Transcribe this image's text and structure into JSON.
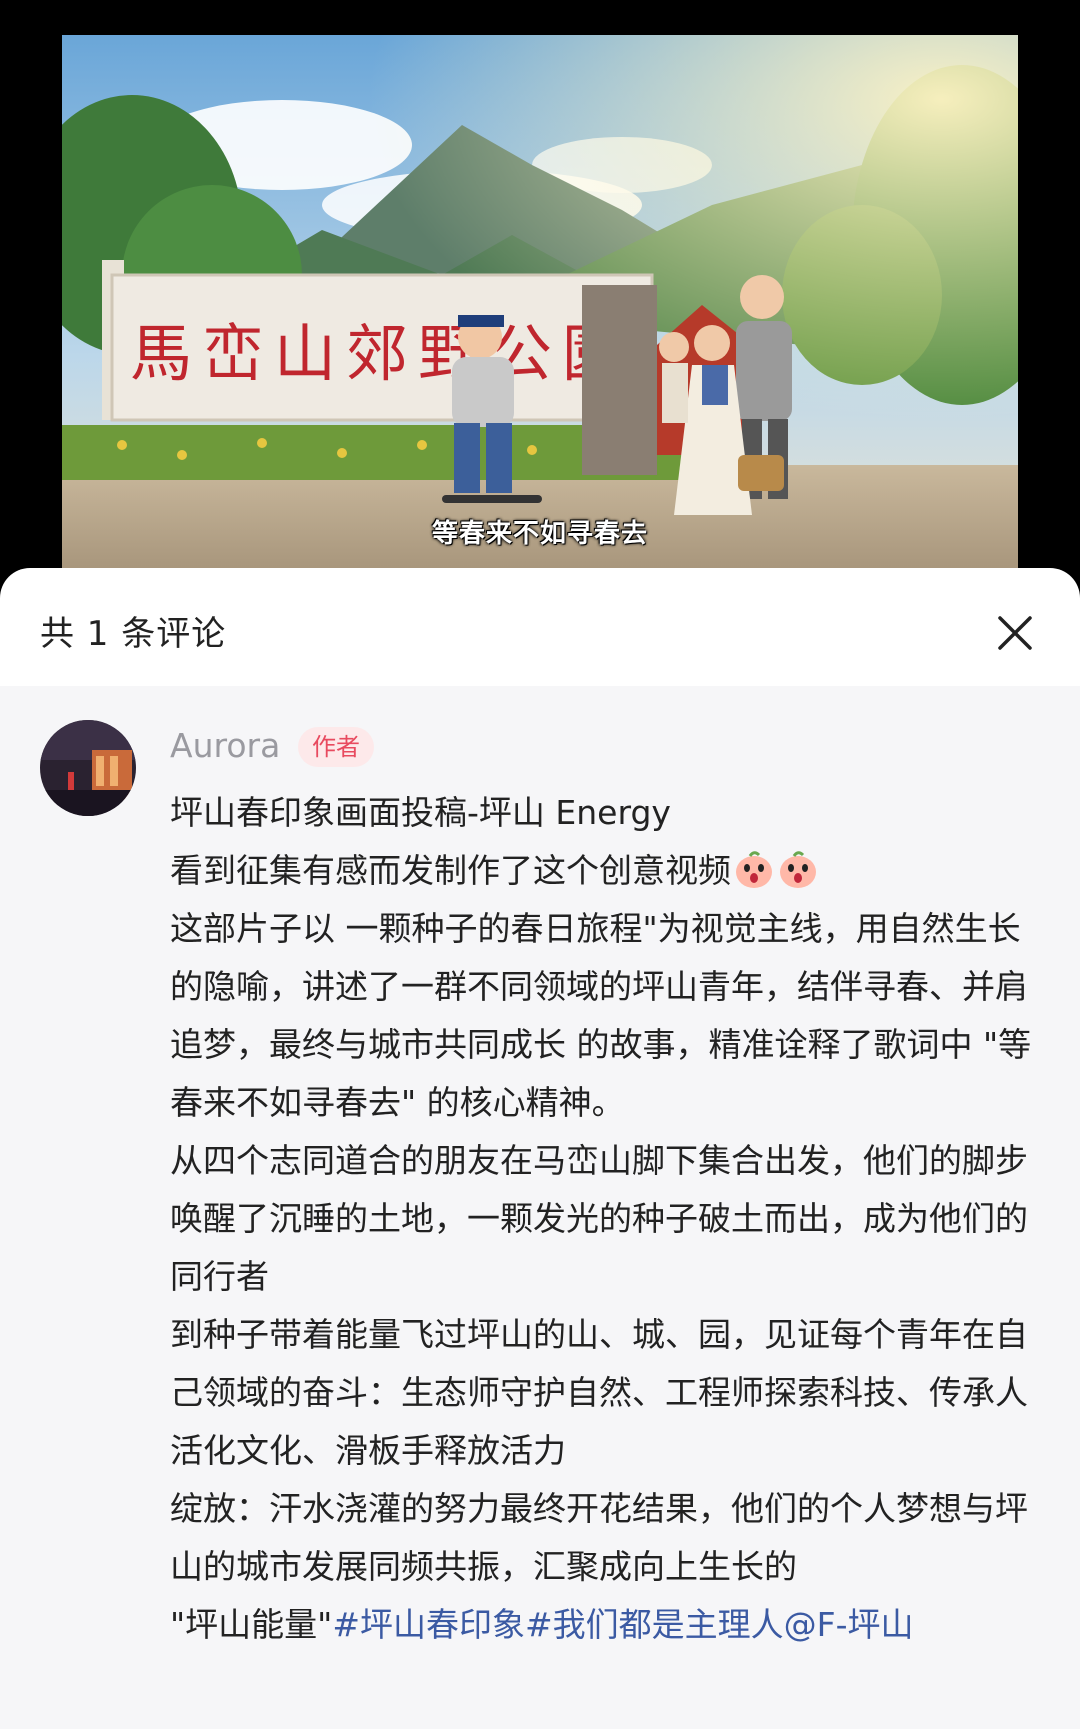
{
  "video": {
    "sign_text": "馬峦山郊野公園",
    "subtitle": "等春来不如寻春去"
  },
  "comments_panel": {
    "title": "共 1 条评论",
    "close_icon": "close-icon"
  },
  "comment": {
    "username": "Aurora",
    "badge": "作者",
    "lines": [
      "坪山春印象画面投稿-坪山 Energy",
      "看到征集有感而发制作了这个创意视频",
      "这部片子以 一颗种子的春日旅程\"为视觉主线，用自然生长的隐喻，讲述了一群不同领域的坪山青年，结伴寻春、并肩追梦，最终与城市共同成长 的故事，精准诠释了歌词中 \"等春来不如寻春去\" 的核心精神。",
      "从四个志同道合的朋友在马峦山脚下集合出发，他们的脚步唤醒了沉睡的土地，一颗发光的种子破土而出，成为他们的同行者",
      "到种子带着能量飞过坪山的山、城、园，见证每个青年在自己领域的奋斗：生态师守护自然、工程师探索科技、传承人活化文化、滑板手释放活力",
      "绽放：汗水浇灌的努力最终开花结果，他们的个人梦想与坪山的城市发展同频共振，汇聚成向上生长的"
    ],
    "last_line_plain": "\"坪山能量\"",
    "tags": [
      "#坪山春印象",
      "#我们都是主理人",
      "@F-坪山"
    ],
    "emoji_name": "peach-face-emoji"
  }
}
